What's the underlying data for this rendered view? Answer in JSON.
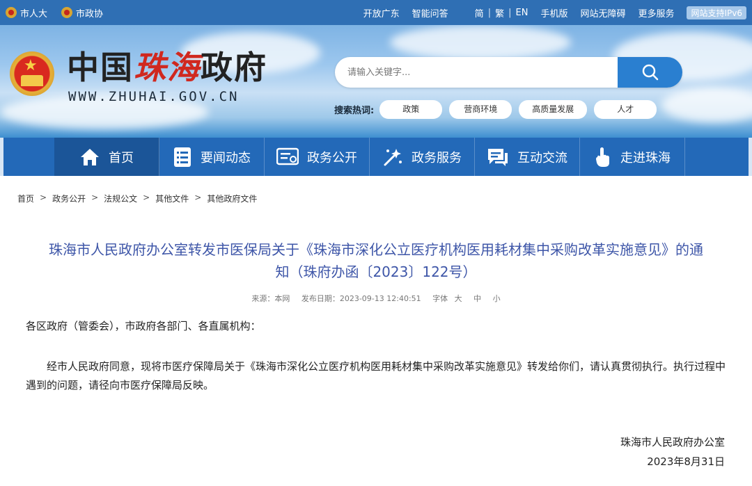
{
  "topbar": {
    "left_links": [
      {
        "label": "市人大",
        "icon": "emblem-icon"
      },
      {
        "label": "市政协",
        "icon": "emblem-icon"
      }
    ],
    "right_links": [
      "开放广东",
      "智能问答",
      "简",
      "繁",
      "EN",
      "手机版",
      "网站无障碍",
      "更多服务"
    ],
    "ipv6_badge": "网站支持IPv6"
  },
  "header": {
    "logo_prefix": "中国",
    "logo_city": "珠海",
    "logo_suffix": "政府",
    "logo_url": "WWW.ZHUHAI.GOV.CN",
    "search_placeholder": "请输入关键字...",
    "search_icon": "search-icon",
    "hot_label": "搜索热词:",
    "hot_tags": [
      "政策",
      "营商环境",
      "高质量发展",
      "人才"
    ]
  },
  "nav": {
    "items": [
      {
        "label": "首页",
        "icon": "home-icon"
      },
      {
        "label": "要闻动态",
        "icon": "news-list-icon"
      },
      {
        "label": "政务公开",
        "icon": "document-icon"
      },
      {
        "label": "政务服务",
        "icon": "service-icon"
      },
      {
        "label": "互动交流",
        "icon": "chat-icon"
      },
      {
        "label": "走进珠海",
        "icon": "hand-pointer-icon"
      }
    ],
    "active_index": 0
  },
  "breadcrumb": [
    "首页",
    "政务公开",
    "法规公文",
    "其他文件",
    "其他政府文件"
  ],
  "article": {
    "title_line1": "珠海市人民政府办公室转发市医保局关于《珠海市深化公立医疗机构医用耗材集中采购改革实施意见》的通",
    "title_line2": "知（珠府办函〔2023〕122号）",
    "meta": {
      "source": "来源：本网",
      "date": "发布日期：2023-09-13 12:40:51",
      "font_label": "字体",
      "font_large": "大",
      "font_medium": "中",
      "font_small": "小"
    },
    "salutation": "各区政府（管委会），市政府各部门、各直属机构：",
    "paragraph": "经市人民政府同意，现将市医疗保障局关于《珠海市深化公立医疗机构医用耗材集中采购改革实施意见》转发给你们，请认真贯彻执行。执行过程中遇到的问题，请径向市医疗保障局反映。",
    "signature": "珠海市人民政府办公室",
    "sign_date": "2023年8月31日"
  },
  "colors": {
    "topbar": "#2f6fb4",
    "nav": "#2369b8",
    "nav_active": "#1b5598",
    "title": "#3e56a8",
    "logo_red": "#d0281f",
    "search_button": "#2a7fd0"
  }
}
